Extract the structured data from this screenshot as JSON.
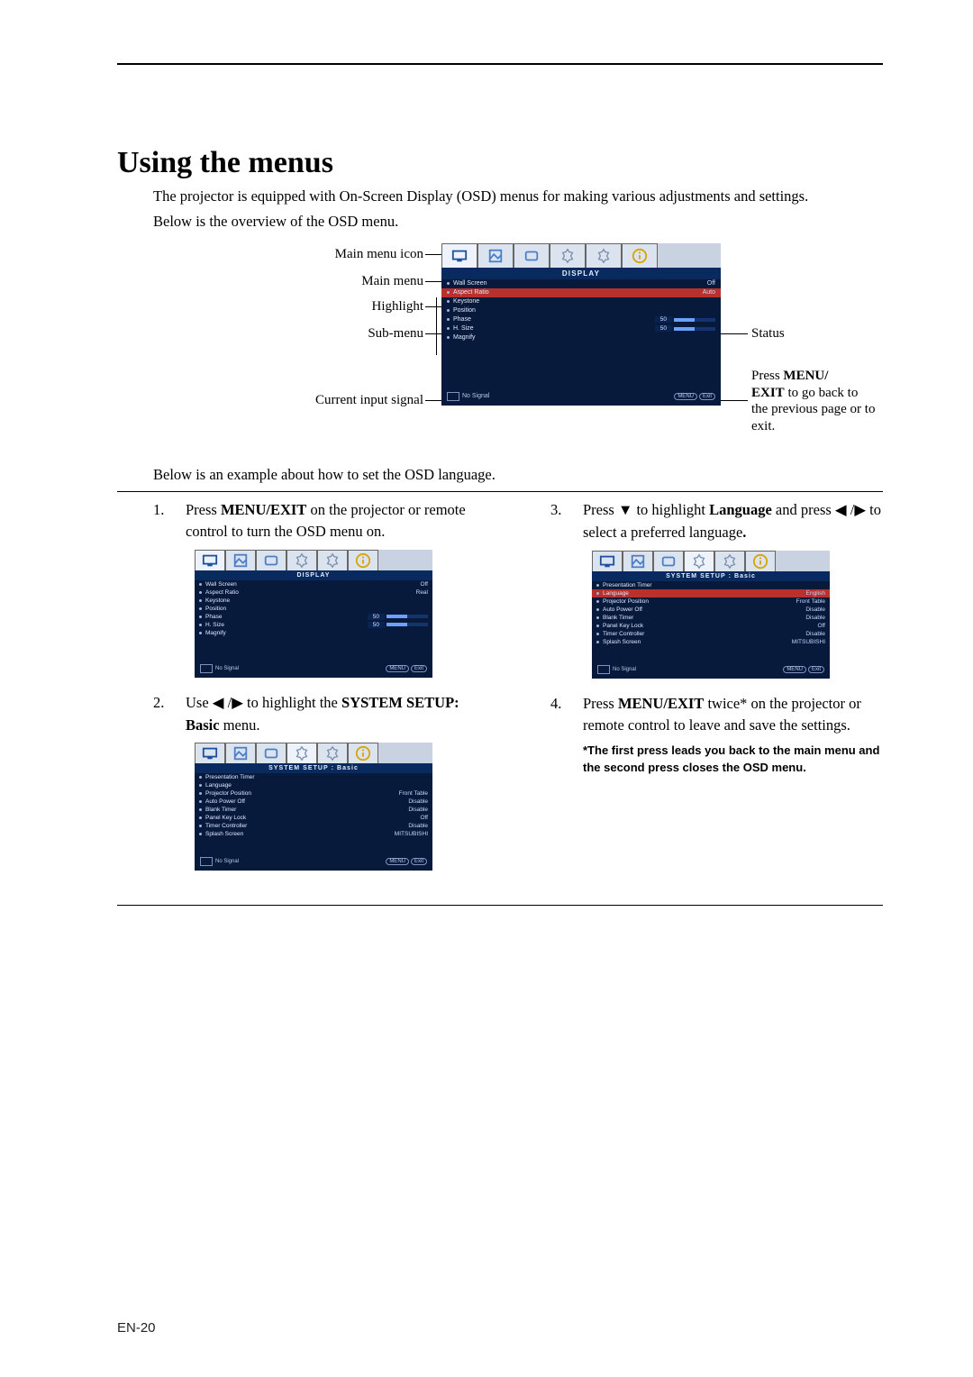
{
  "page": {
    "number": "EN-20",
    "heading": "Using the menus"
  },
  "intro": {
    "p1": "The projector is equipped with On-Screen Display (OSD) menus for making various adjustments and settings.",
    "p2": "Below is the overview of the OSD menu.",
    "p3": "Below is an example about how to set the OSD language."
  },
  "annot": {
    "main_icon": "Main menu icon",
    "main_menu": "Main menu",
    "highlight": "Highlight",
    "sub_menu": "Sub-menu",
    "cur_signal": "Current input signal",
    "status": "Status",
    "exit_note_1": "Press ",
    "exit_note_b1": "MENU/",
    "exit_note_b2": "EXIT",
    "exit_note_2": " to go back to the previous page or to exit."
  },
  "osd_main": {
    "title": "DISPLAY",
    "items": [
      {
        "label": "Wall Screen",
        "value": "Off"
      },
      {
        "label": "Aspect Ratio",
        "value": "Auto"
      },
      {
        "label": "Keystone",
        "value": ""
      },
      {
        "label": "Position",
        "value": ""
      },
      {
        "label": "Phase",
        "value": "50",
        "bar": true
      },
      {
        "label": "H. Size",
        "value": "50",
        "bar": true
      },
      {
        "label": "Magnify",
        "value": ""
      }
    ],
    "signal": "No Signal",
    "btn_menu": "MENU",
    "btn_exit": "Exit",
    "hl_index": 1
  },
  "osd_step1": {
    "title": "DISPLAY",
    "items": [
      {
        "label": "Wall Screen",
        "value": "Off"
      },
      {
        "label": "Aspect Ratio",
        "value": "Real"
      },
      {
        "label": "Keystone",
        "value": ""
      },
      {
        "label": "Position",
        "value": ""
      },
      {
        "label": "Phase",
        "value": "50",
        "bar": true
      },
      {
        "label": "H. Size",
        "value": "50",
        "bar": true
      },
      {
        "label": "Magnify",
        "value": ""
      }
    ],
    "signal": "No Signal",
    "btn_menu": "MENU",
    "btn_exit": "Exit",
    "hl_index": -1
  },
  "osd_step2": {
    "title": "SYSTEM SETUP : Basic",
    "items": [
      {
        "label": "Presentation Timer",
        "value": ""
      },
      {
        "label": "Language",
        "value": ""
      },
      {
        "label": "Projector Position",
        "value": "Front Table"
      },
      {
        "label": "Auto Power Off",
        "value": "Disable"
      },
      {
        "label": "Blank Timer",
        "value": "Disable"
      },
      {
        "label": "Panel Key Lock",
        "value": "Off"
      },
      {
        "label": "Timer Controller",
        "value": "Disable"
      },
      {
        "label": "Splash Screen",
        "value": "MITSUBISHI"
      }
    ],
    "signal": "No Signal",
    "btn_menu": "MENU",
    "btn_exit": "Exit",
    "hl_index": -1
  },
  "osd_step3": {
    "title": "SYSTEM SETUP : Basic",
    "items": [
      {
        "label": "Presentation Timer",
        "value": ""
      },
      {
        "label": "Language",
        "value": "English"
      },
      {
        "label": "Projector Position",
        "value": "Front Table"
      },
      {
        "label": "Auto Power Off",
        "value": "Disable"
      },
      {
        "label": "Blank Timer",
        "value": "Disable"
      },
      {
        "label": "Panel Key Lock",
        "value": "Off"
      },
      {
        "label": "Timer Controller",
        "value": "Disable"
      },
      {
        "label": "Splash Screen",
        "value": "MITSUBISHI"
      }
    ],
    "signal": "No Signal",
    "btn_menu": "MENU",
    "btn_exit": "Exit",
    "hl_index": 1
  },
  "steps": {
    "s1_t1": "Press ",
    "s1_b": "MENU/EXIT",
    "s1_t2": " on the projector or remote control to turn the OSD menu on.",
    "s2_t1": "Use ",
    "s2_t2": " to highlight the ",
    "s2_b": "SYSTEM SETUP: Basic",
    "s2_t3": " menu.",
    "s3_t1": "Press ",
    "s3_t2": " to highlight ",
    "s3_b": "Language",
    "s3_t3": " and press ",
    "s3_t4": " to select a preferred language",
    "s3_dot": ".",
    "s4_t1": "Press ",
    "s4_b": "MENU/EXIT",
    "s4_t2": " twice* on the projector or remote control to leave and save the settings.",
    "note": "*The first press leads you back to the main menu and the second press closes the OSD menu."
  },
  "arrows": {
    "left": "◀",
    "right": "▶",
    "down": "▼",
    "sep": " /"
  }
}
